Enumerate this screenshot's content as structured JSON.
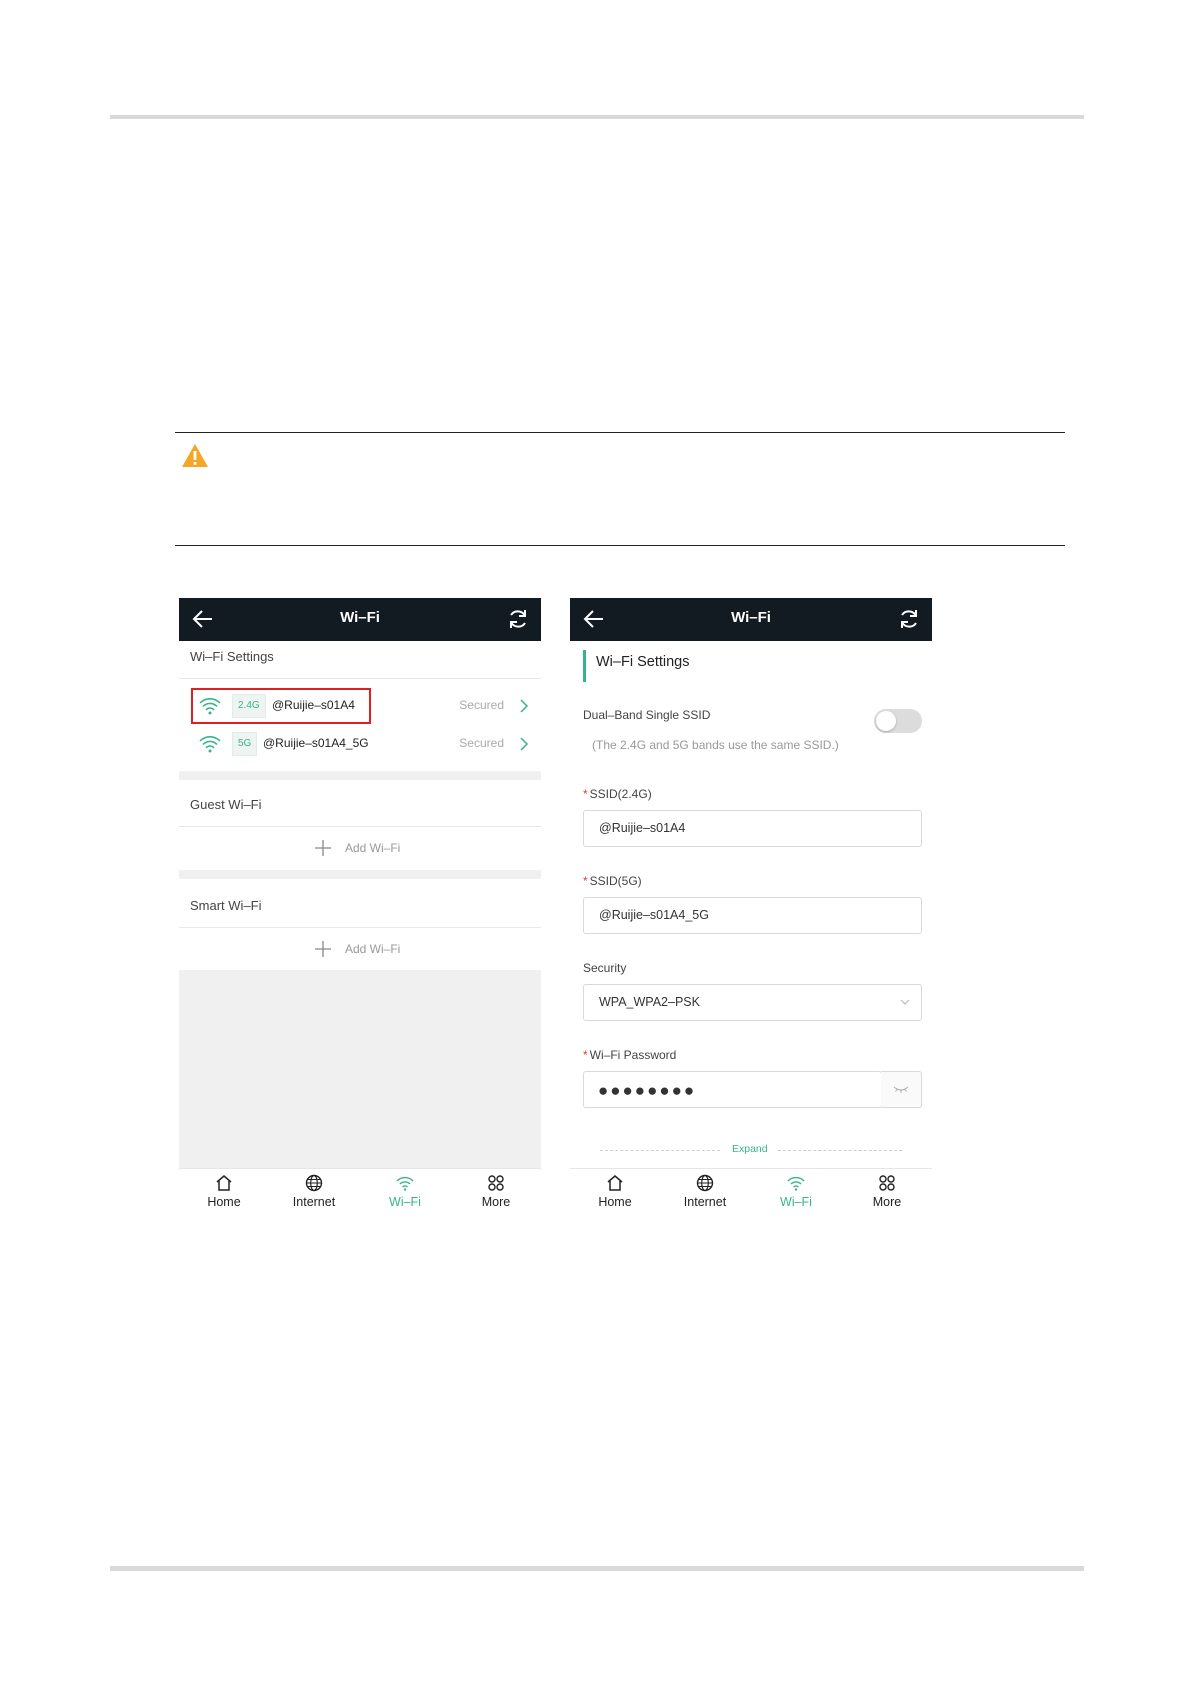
{
  "left_screen": {
    "app_title": "Wi–Fi",
    "wifi_settings_title": "Wi–Fi Settings",
    "ssids": [
      {
        "band": "2.4G",
        "name": "@Ruijie–s01A4",
        "status": "Secured"
      },
      {
        "band": "5G",
        "name": "@Ruijie–s01A4_5G",
        "status": "Secured"
      }
    ],
    "guest_title": "Guest Wi–Fi",
    "guest_add": "Add Wi–Fi",
    "smart_title": "Smart Wi–Fi",
    "smart_add": "Add Wi–Fi"
  },
  "right_screen": {
    "app_title": "Wi–Fi",
    "section_title": "Wi–Fi Settings",
    "dual_band_label": "Dual–Band Single SSID",
    "dual_band_enabled": false,
    "dual_band_hint": "(The 2.4G and 5G bands use the same SSID.)",
    "required_mark": "*",
    "ssid24_label": "SSID(2.4G)",
    "ssid24_value": "@Ruijie–s01A4",
    "ssid5_label": "SSID(5G)",
    "ssid5_value": "@Ruijie–s01A4_5G",
    "security_label": "Security",
    "security_value": "WPA_WPA2–PSK",
    "password_label": "Wi–Fi Password",
    "password_mask": "●●●●●●●●",
    "expand_label": "Expand"
  },
  "tabs": [
    {
      "label": "Home",
      "icon": "home-icon"
    },
    {
      "label": "Internet",
      "icon": "globe-icon"
    },
    {
      "label": "Wi–Fi",
      "icon": "wifi-icon",
      "active": true
    },
    {
      "label": "More",
      "icon": "more-icon"
    }
  ],
  "colors": {
    "accent": "#38b48b",
    "header": "#121a22",
    "highlight": "#e02020",
    "warning": "#f5a623"
  }
}
